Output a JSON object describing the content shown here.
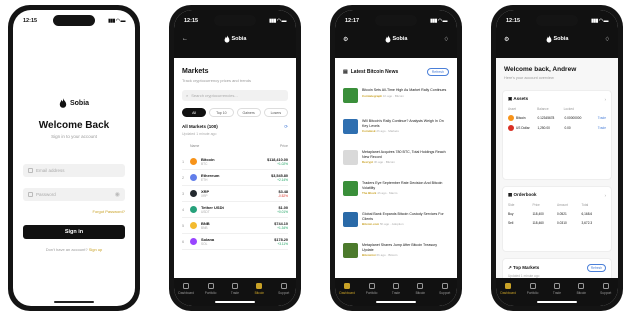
{
  "status": {
    "time": "12:15",
    "time_news": "12:17",
    "signal": "▮▮▮ ◠ ▬"
  },
  "brand": "Sobia",
  "login": {
    "title": "Welcome Back",
    "subtitle": "Sign in to your account",
    "email_placeholder": "Email address",
    "password_placeholder": "Password",
    "forgot": "Forgot Password?",
    "signin": "Sign in",
    "no_account": "Don't have an account?",
    "signup": "Sign up"
  },
  "markets": {
    "title": "Markets",
    "subtitle": "Track cryptocurrency prices and trends",
    "search_placeholder": "Search cryptocurrencies...",
    "chips": [
      "All",
      "Top 10",
      "Gainers",
      "Losers"
    ],
    "card_title": "All Markets (100)",
    "card_refresh": "⟳",
    "card_sub": "Updated 1 minute ago",
    "col_name": "Name",
    "col_price": "Price",
    "coins": [
      {
        "rank": "1",
        "name": "Bitcoin",
        "sym": "BTC",
        "price": "$118,410.00",
        "chg": "+1.02%",
        "color": "#f7931a",
        "chg_color": "#1aa260"
      },
      {
        "rank": "2",
        "name": "Ethereum",
        "sym": "ETH",
        "price": "$3,545.80",
        "chg": "+2.14%",
        "color": "#627eea",
        "chg_color": "#1aa260"
      },
      {
        "rank": "3",
        "name": "XRP",
        "sym": "XRP",
        "price": "$3.48",
        "chg": "-0.52%",
        "color": "#23292f",
        "chg_color": "#d93025"
      },
      {
        "rank": "4",
        "name": "Tether USDt",
        "sym": "USDT",
        "price": "$1.00",
        "chg": "+0.01%",
        "color": "#26a17b",
        "chg_color": "#1aa260"
      },
      {
        "rank": "5",
        "name": "BNB",
        "sym": "BNB",
        "price": "$744.10",
        "chg": "+1.34%",
        "color": "#f3ba2f",
        "chg_color": "#1aa260"
      },
      {
        "rank": "6",
        "name": "Solana",
        "sym": "SOL",
        "price": "$178.20",
        "chg": "+3.11%",
        "color": "#9945ff",
        "chg_color": "#1aa260"
      }
    ]
  },
  "news": {
    "title": "Latest Bitcoin News",
    "refresh": "Refresh",
    "items": [
      {
        "title": "Bitcoin Sets All-Time High As Market Rally Continues",
        "source": "Cointelegraph",
        "ago": "1h ago",
        "extra": "Bitcoin",
        "thumb": "#3a8f3a"
      },
      {
        "title": "Will Bitcoin's Rally Continue? Analysts Weigh In On Key Levels",
        "source": "Coindesk",
        "ago": "2h ago",
        "extra": "Markets",
        "thumb": "#2f6fb0"
      },
      {
        "title": "Metaplanet Acquires 780 BTC, Total Holdings Reach New Record",
        "source": "Decrypt",
        "ago": "3h ago",
        "extra": "Bitcoin",
        "thumb": "#d9d9d9"
      },
      {
        "title": "Traders Eye September Rate Decision And Bitcoin Volatility",
        "source": "The Block",
        "ago": "4h ago",
        "extra": "Macro",
        "thumb": "#3a8f3a"
      },
      {
        "title": "Global Bank Expands Bitcoin Custody Services For Clients",
        "source": "Bitcoin.com",
        "ago": "5h ago",
        "extra": "Adoption",
        "thumb": "#2a6aa8"
      },
      {
        "title": "Metaplanet Shares Jump After Bitcoin Treasury Update",
        "source": "Bitcoinist",
        "ago": "6h ago",
        "extra": "Bitcoin",
        "thumb": "#4c7a2c"
      }
    ]
  },
  "dashboard": {
    "title": "Welcome back, Andrew",
    "subtitle": "Here's your account overview",
    "assets_title": "Assets",
    "assets_cols": [
      "Asset",
      "Balance",
      "Locked",
      ""
    ],
    "assets": [
      {
        "name": "Bitcoin",
        "bal": "0.12345678",
        "locked": "0.00000000",
        "act": "Trade",
        "color": "#f7931a"
      },
      {
        "name": "US Dollar",
        "bal": "1,250.00",
        "locked": "0.00",
        "act": "Trade",
        "color": "#d93025"
      }
    ],
    "orders_title": "Orderbook",
    "orders_cols": [
      "Side",
      "Price",
      "Amount",
      "Total"
    ],
    "orders": [
      [
        "Buy",
        "118,400",
        "0.0521",
        "6,168.6"
      ],
      [
        "Sell",
        "118,460",
        "0.0310",
        "3,672.3"
      ]
    ],
    "top_title": "Top Markets",
    "top_update": "Updated 1 minute ago",
    "top_refresh": "Refresh"
  },
  "tabs": {
    "markets": [
      "Dashboard",
      "Portfolio",
      "Trade",
      "Bitcoin",
      "Support"
    ],
    "news": [
      "Dashboard",
      "Portfolio",
      "Trade",
      "Bitcoin",
      "Support"
    ],
    "dashboard": [
      "Dashboard",
      "Portfolio",
      "Trade",
      "Bitcoin",
      "Support"
    ]
  }
}
